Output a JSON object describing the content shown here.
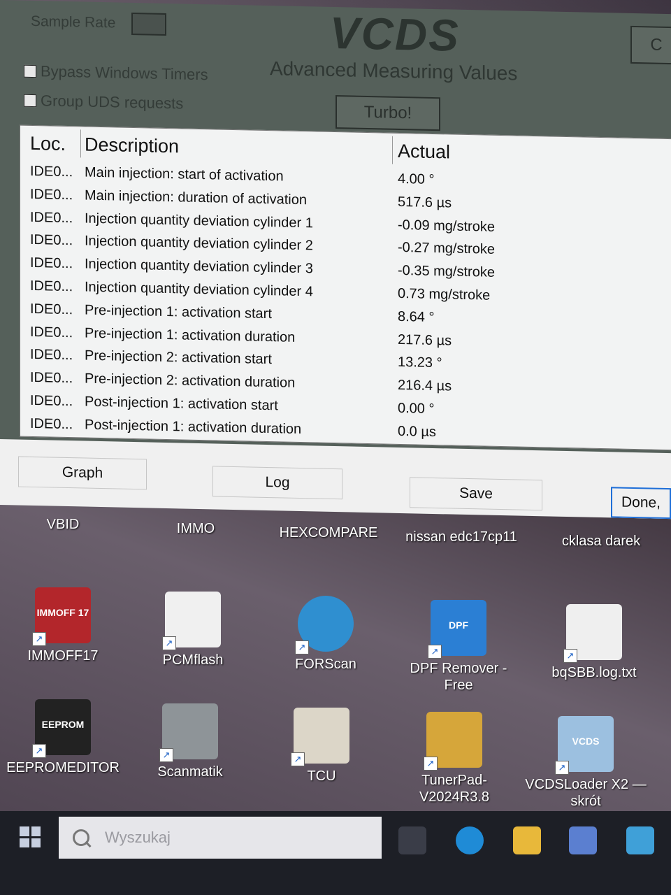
{
  "window": {
    "title": "VCDS",
    "subtitle": "Advanced Measuring Values",
    "sample_rate_label": "Sample Rate",
    "bypass_timers_label": "Bypass Windows Timers",
    "group_uds_label": "Group UDS requests",
    "turbo_label": "Turbo!",
    "c_label": "C"
  },
  "table": {
    "headers": {
      "loc": "Loc.",
      "description": "Description",
      "actual": "Actual"
    },
    "rows": [
      {
        "loc": "IDE0...",
        "description": "Main injection: start of activation",
        "actual": "4.00 °"
      },
      {
        "loc": "IDE0...",
        "description": "Main injection: duration of activation",
        "actual": "517.6 µs"
      },
      {
        "loc": "IDE0...",
        "description": "Injection quantity deviation cylinder 1",
        "actual": "-0.09 mg/stroke"
      },
      {
        "loc": "IDE0...",
        "description": "Injection quantity deviation cylinder 2",
        "actual": "-0.27 mg/stroke"
      },
      {
        "loc": "IDE0...",
        "description": "Injection quantity deviation cylinder 3",
        "actual": "-0.35 mg/stroke"
      },
      {
        "loc": "IDE0...",
        "description": "Injection quantity deviation cylinder 4",
        "actual": "0.73 mg/stroke"
      },
      {
        "loc": "IDE0...",
        "description": "Pre-injection 1: activation start",
        "actual": "8.64 °"
      },
      {
        "loc": "IDE0...",
        "description": "Pre-injection 1: activation duration",
        "actual": "217.6 µs"
      },
      {
        "loc": "IDE0...",
        "description": "Pre-injection 2: activation start",
        "actual": "13.23 °"
      },
      {
        "loc": "IDE0...",
        "description": "Pre-injection 2: activation duration",
        "actual": "216.4 µs"
      },
      {
        "loc": "IDE0...",
        "description": "Post-injection 1: activation start",
        "actual": "0.00 °"
      },
      {
        "loc": "IDE0...",
        "description": "Post-injection 1: activation duration",
        "actual": "0.0 µs"
      }
    ]
  },
  "buttons": {
    "graph": "Graph",
    "log": "Log",
    "save": "Save",
    "done": "Done,"
  },
  "desktop_icons": [
    {
      "name": "VBID",
      "icon": "app-icon"
    },
    {
      "name": "IMMO",
      "icon": "app-icon"
    },
    {
      "name": "HEXCOMPARE",
      "icon": "app-icon"
    },
    {
      "name": "nissan edc17cp11",
      "icon": "folder-icon"
    },
    {
      "name": "cklasa darek",
      "icon": "folder-icon"
    },
    {
      "name": "IMMOFF17",
      "icon": "immoff-icon",
      "badge": "IMMOFF 17"
    },
    {
      "name": "PCMflash",
      "icon": "lightning-icon"
    },
    {
      "name": "FORScan",
      "icon": "car-icon"
    },
    {
      "name": "DPF Remover - Free",
      "icon": "dpf-icon",
      "badge": "DPF"
    },
    {
      "name": "bqSBB.log.txt",
      "icon": "text-file-icon"
    },
    {
      "name": "EEPROMEDITOR",
      "icon": "eeprom-icon",
      "badge": "EEPROM"
    },
    {
      "name": "Scanmatik",
      "icon": "scanmatik-icon"
    },
    {
      "name": "TCU",
      "icon": "document-icon"
    },
    {
      "name": "TunerPad-V2024R3.8",
      "icon": "chip-icon"
    },
    {
      "name": "VCDSLoader X2 — skrót",
      "icon": "vcds-icon",
      "badge": "VCDS"
    }
  ],
  "taskbar": {
    "search_placeholder": "Wyszukaj"
  },
  "colors": {
    "window_bg": "#55605a",
    "list_bg": "#f2f3f3",
    "accent": "#1f6fd8",
    "taskbar": "#1d1f26"
  }
}
